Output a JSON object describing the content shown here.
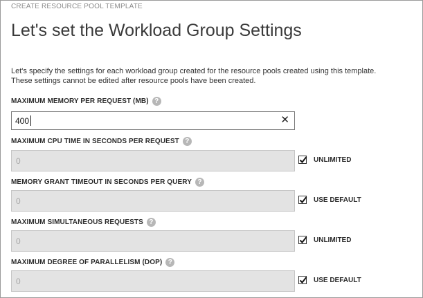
{
  "header": {
    "wizard_label": "CREATE RESOURCE POOL TEMPLATE",
    "title": "Let's set the Workload Group Settings",
    "description_line1": "Let's specify the settings for each workload group created for the resource pools created using this template.",
    "description_line2": "These settings cannot be edited after resource pools have been created."
  },
  "fields": {
    "max_memory": {
      "label": "MAXIMUM MEMORY PER REQUEST (MB)",
      "value": "400"
    },
    "max_cpu": {
      "label": "MAXIMUM CPU TIME IN SECONDS PER REQUEST",
      "value": "0",
      "checkbox_label": "UNLIMITED",
      "checked": true
    },
    "grant_timeout": {
      "label": "MEMORY GRANT TIMEOUT IN SECONDS PER QUERY",
      "value": "0",
      "checkbox_label": "USE DEFAULT",
      "checked": true
    },
    "max_requests": {
      "label": "MAXIMUM SIMULTANEOUS REQUESTS",
      "value": "0",
      "checkbox_label": "UNLIMITED",
      "checked": true
    },
    "max_dop": {
      "label": "MAXIMUM DEGREE OF PARALLELISM (DOP)",
      "value": "0",
      "checkbox_label": "USE DEFAULT",
      "checked": true
    }
  },
  "icons": {
    "help": "?",
    "clear": "✕"
  },
  "colors": {
    "disabled_field": "#e3e3e3",
    "help_icon": "#b7b7b7"
  }
}
